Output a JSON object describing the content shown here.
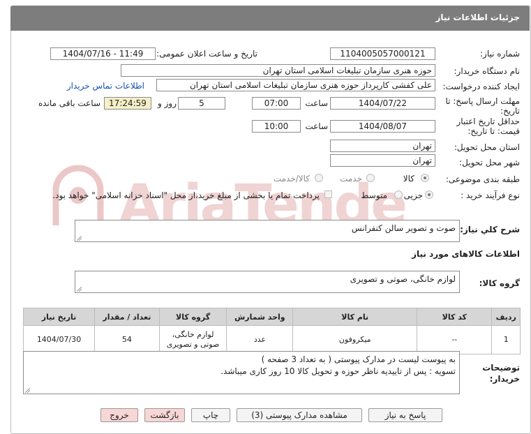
{
  "header": {
    "title": "جزئیات اطلاعات نیاز"
  },
  "form": {
    "need_number_label": "شماره نیاز:",
    "need_number": "1104005057000121",
    "announce_label": "تاریخ و ساعت اعلان عمومی:",
    "announce_value": "1404/07/16 - 11:49",
    "buyer_org_label": "نام دستگاه خریدار:",
    "buyer_org": "حوزه هنری سازمان تبلیغات اسلامی استان تهران",
    "requester_label": "ایجاد کننده درخواست:",
    "requester": "علی کفشی کارپرداز حوزه هنری سازمان تبلیغات اسلامی استان تهران",
    "contact_link": "اطلاعات تماس خریدار",
    "reply_deadline_label_1": "مهلت ارسال پاسخ: تا",
    "reply_deadline_label_2": "تاریخ:",
    "reply_date": "1404/07/22",
    "time_label": "ساعت",
    "reply_time": "07:00",
    "days": "5",
    "days_label": "روز و",
    "remaining_time": "17:24:59",
    "remaining_label": "ساعت باقی مانده",
    "validity_label_1": "حداقل تاریخ اعتبار",
    "validity_label_2": "قیمت: تا تاریخ:",
    "validity_date": "1404/08/07",
    "validity_time": "10:00",
    "province_label": "استان محل تحویل:",
    "province": "تهران",
    "city_label": "شهر محل تحویل:",
    "city": "تهران",
    "category_label": "طبقه بندی موضوعی:",
    "category_options": [
      "کالا",
      "خدمت",
      "کالا/خدمت"
    ],
    "category_selected": "کالا",
    "process_label": "نوع فرآیند خرید :",
    "process_options": [
      "جزیی",
      "متوسط"
    ],
    "process_selected": "جزیی",
    "payment_note": "پرداخت تمام یا بخشی از مبلغ خرید،از محل \"اسناد خزانه اسلامی\" خواهد بود.",
    "summary_label": "شرح کلي نياز:",
    "summary": "صوت و تصویر سالن کنفرانس",
    "goods_info_title": "اطلاعات کالاهای مورد نیاز",
    "goods_group_label": "گروه کالا:",
    "goods_group": "لوازم خانگی، صوتی و تصویری",
    "buyer_notes_label_1": "توضیحات",
    "buyer_notes_label_2": "خریدار:",
    "buyer_notes_line1": "به پیوست لیست در مدارک پیوستی ( به تعداد 3 صفحه )",
    "buyer_notes_line2": "تسویه : پس از تاییدیه ناظر حوزه و تحویل کالا 10 روز کاری میباشد."
  },
  "table": {
    "headers": [
      "ردیف",
      "کد کالا",
      "نام کالا",
      "واحد شمارش",
      "گروه کالا",
      "تعداد / مقدار",
      "تاریخ نیاز"
    ],
    "rows": [
      {
        "row": "1",
        "code": "--",
        "name": "میکروفون",
        "unit": "عدد",
        "group_line1": "لوازم خانگی،",
        "group_line2": "صوتی و تصویری",
        "qty": "54",
        "date": "1404/07/30"
      }
    ]
  },
  "buttons": {
    "reply": "پاسخ به نیاز",
    "view_docs": "مشاهده مدارک پیوستی (3)",
    "print": "چاپ",
    "back": "بازگشت",
    "exit": "خروج"
  },
  "watermark": {
    "text": "AriaTender.net"
  },
  "colors": {
    "header_bg": "#7d7d7d",
    "link": "#1a4fb4",
    "remaining_bg": "#f5f0c8",
    "table_header_bg": "#d6d6d6",
    "watermark": "#e6b9b9"
  }
}
